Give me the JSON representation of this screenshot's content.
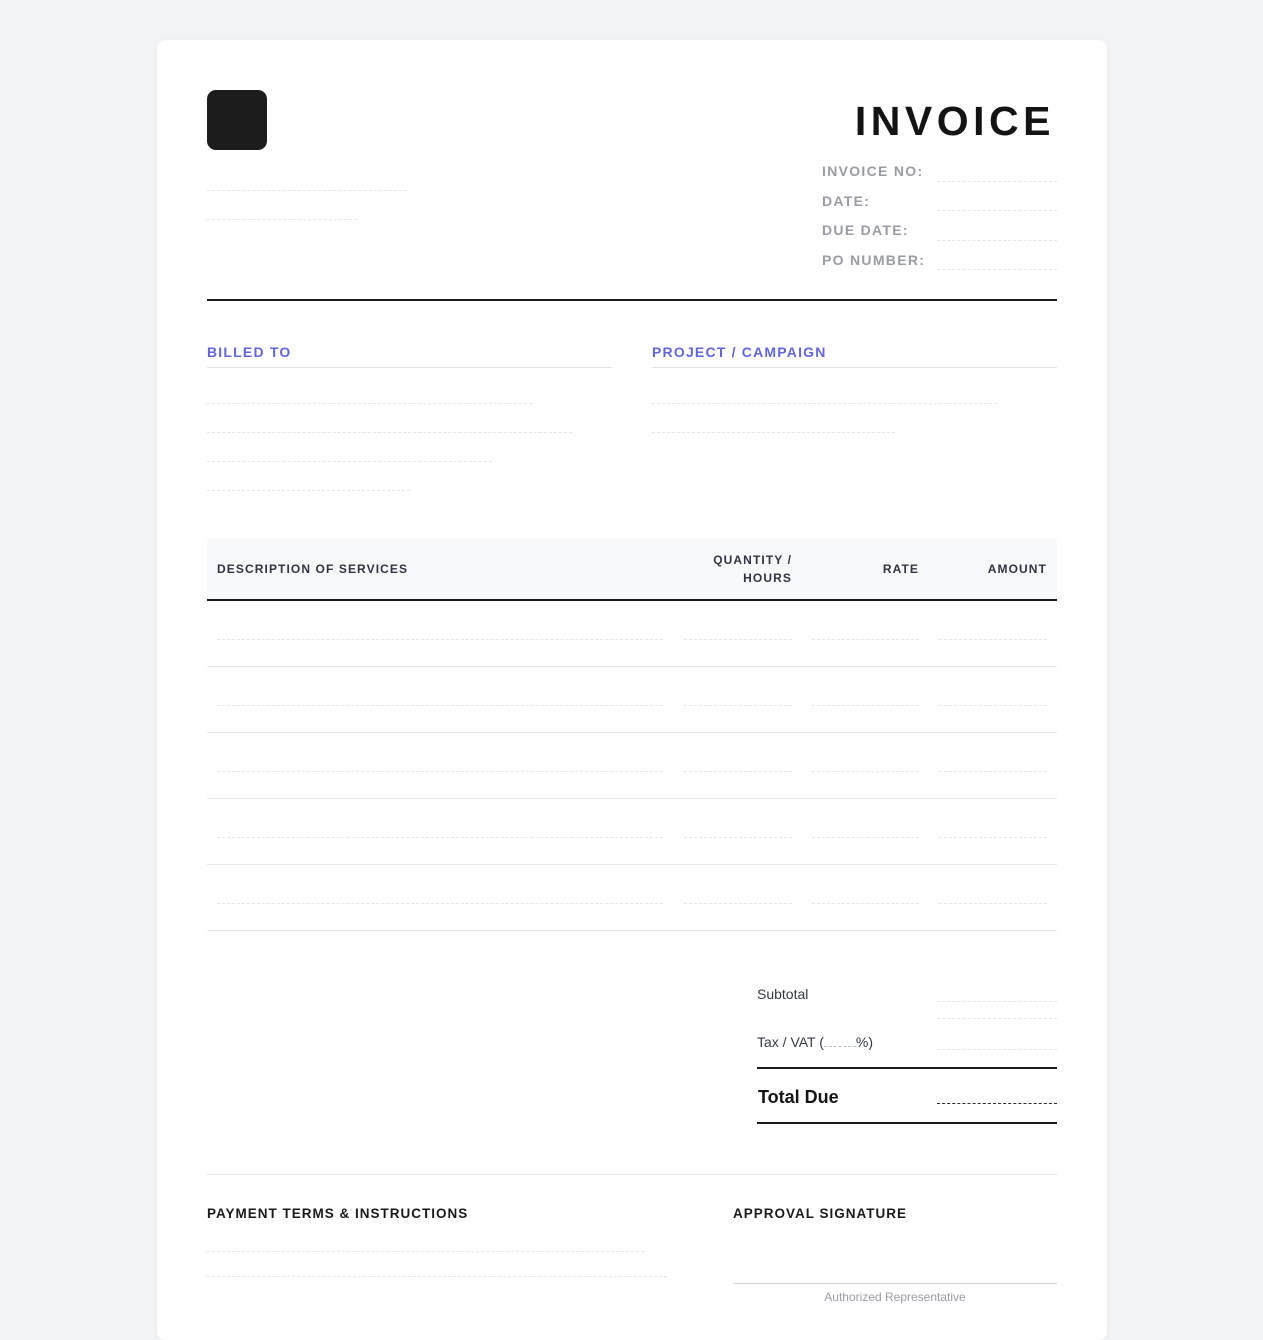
{
  "header": {
    "title": "INVOICE",
    "meta_labels": {
      "invoice_no": "INVOICE NO:",
      "date": "DATE:",
      "due_date": "DUE DATE:",
      "po_number": "PO NUMBER:"
    }
  },
  "parties": {
    "billed_to": "BILLED TO",
    "project": "PROJECT / CAMPAIGN"
  },
  "table": {
    "headers": {
      "description": "DESCRIPTION OF SERVICES",
      "quantity_line1": "QUANTITY /",
      "quantity_line2": "HOURS",
      "rate": "RATE",
      "amount": "AMOUNT"
    },
    "row_count": 5
  },
  "totals": {
    "subtotal": "Subtotal",
    "tax_prefix": "Tax / VAT (",
    "tax_suffix": "%)",
    "total_due": "Total Due"
  },
  "footer": {
    "payment_terms": "PAYMENT TERMS & INSTRUCTIONS",
    "approval": "APPROVAL SIGNATURE",
    "signature_caption": "Authorized Representative"
  }
}
